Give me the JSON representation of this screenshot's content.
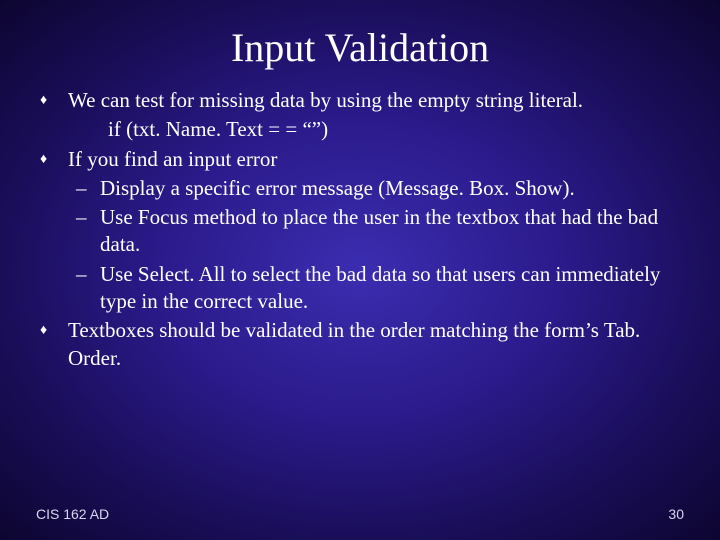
{
  "title": "Input Validation",
  "bullets": [
    {
      "text": "We can test for missing data by using the empty string literal.",
      "code": "if (txt. Name. Text = = “”)"
    },
    {
      "text": "If you find an input error",
      "sub": [
        "Display a specific error message (Message. Box. Show).",
        "Use Focus method to place the user in the textbox that had the bad data.",
        "Use Select. All to select the bad data so that users can immediately type in the correct value."
      ]
    },
    {
      "text": "Textboxes should be validated in the order matching the form’s Tab. Order."
    }
  ],
  "footer": {
    "left": "CIS 162 AD",
    "right": "30"
  },
  "markers": {
    "l1": "♦",
    "l2": "–"
  }
}
